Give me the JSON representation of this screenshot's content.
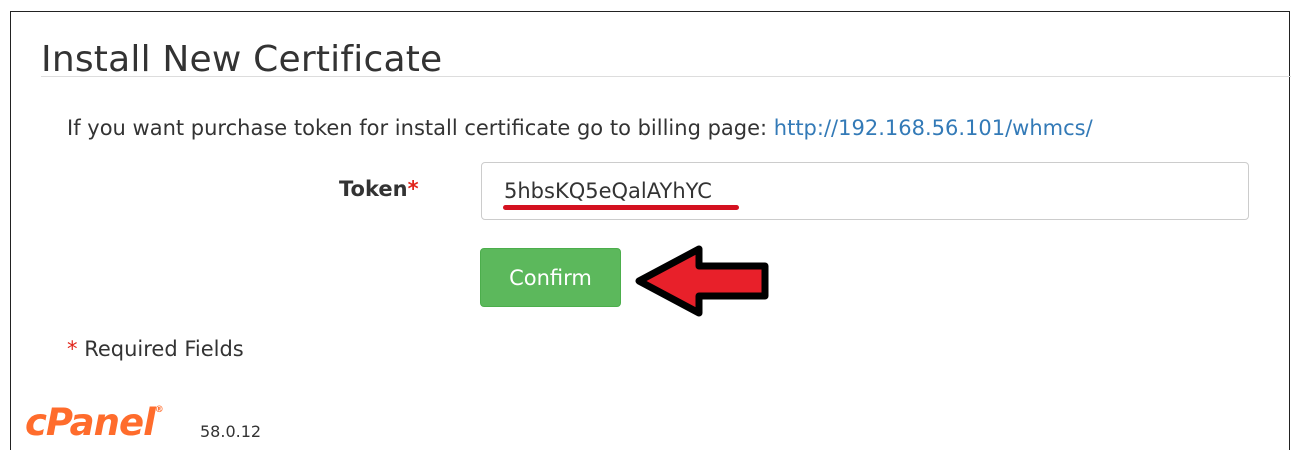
{
  "page": {
    "title": "Install New Certificate"
  },
  "info": {
    "text": "If you want purchase token for install certificate go to billing page: ",
    "link_text": "http://192.168.56.101/whmcs/"
  },
  "form": {
    "token_label": "Token",
    "required_marker": "*",
    "token_value": "5hbsKQ5eQalAYhYC",
    "confirm_label": "Confirm",
    "required_fields_text": "Required Fields"
  },
  "footer": {
    "logo_text": "cPanel",
    "logo_mark": "®",
    "version": "58.0.12"
  },
  "colors": {
    "confirm_button": "#5cb85c",
    "required_marker": "#e1251b",
    "link": "#337ab7",
    "annotation_arrow": "#e8202a",
    "logo": "#ff6c2c"
  },
  "icons": {
    "annotation": "left-arrow-icon"
  }
}
